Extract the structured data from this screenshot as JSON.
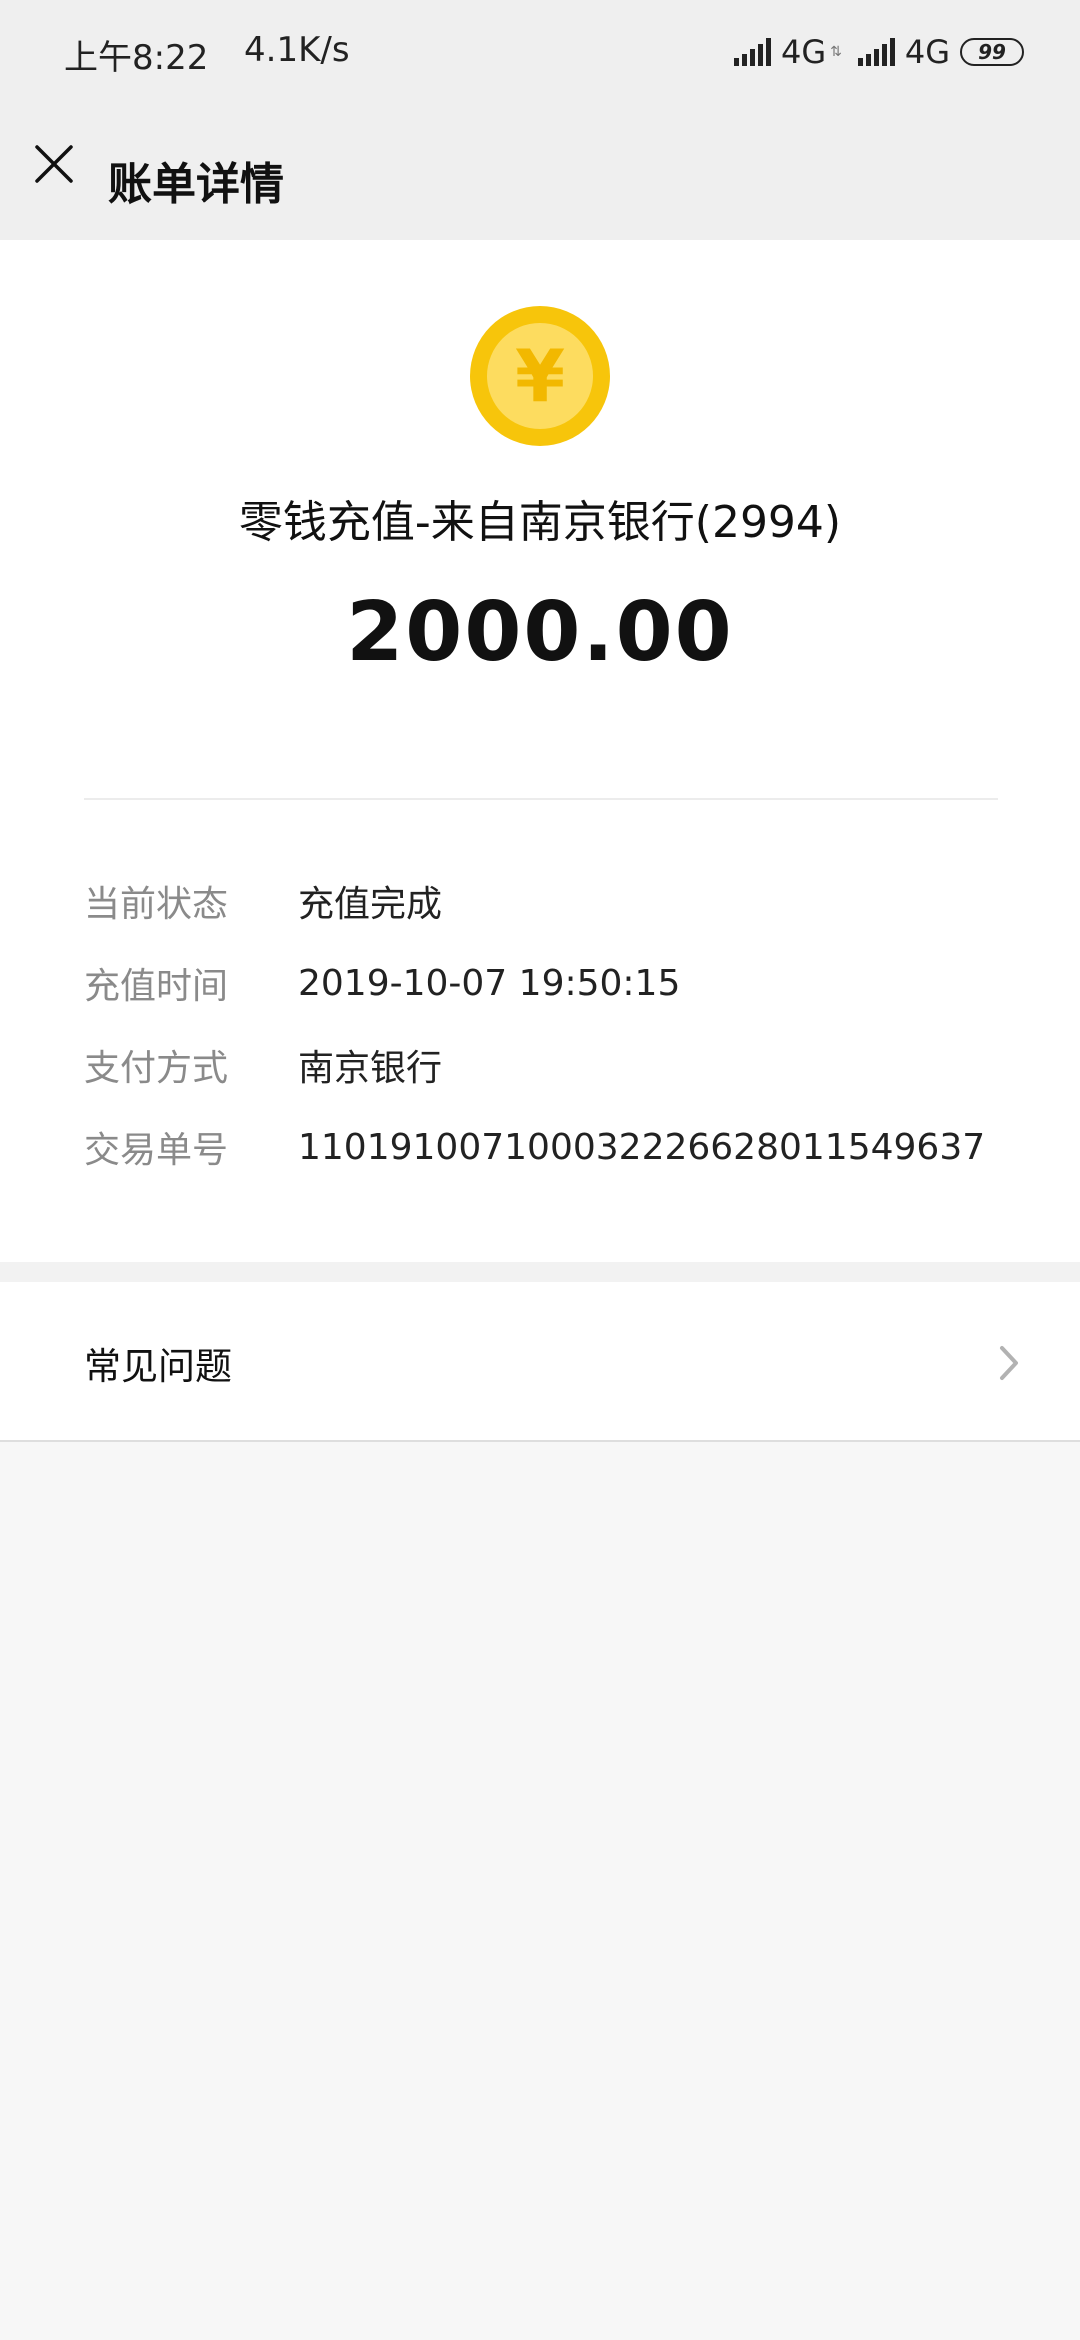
{
  "status_bar": {
    "time": "上午8:22",
    "speed": "4.1K/s",
    "network1": "4G",
    "network2": "4G",
    "battery": "99"
  },
  "header": {
    "title": "账单详情",
    "close_icon": "close-icon"
  },
  "transaction": {
    "icon": "yuan-coin-icon",
    "icon_symbol": "¥",
    "title": "零钱充值-来自南京银行(2994)",
    "amount": "2000.00"
  },
  "details": [
    {
      "label": "当前状态",
      "value": "充值完成"
    },
    {
      "label": "充值时间",
      "value": "2019-10-07 19:50:15"
    },
    {
      "label": "支付方式",
      "value": "南京银行"
    },
    {
      "label": "交易单号",
      "value": "110191007100032226628011549637"
    }
  ],
  "faq": {
    "label": "常见问题",
    "chevron_icon": "chevron-right-icon"
  },
  "colors": {
    "coin_outer": "#f7c50b",
    "coin_inner": "#fddc5f",
    "header_bg": "#efefef",
    "page_bg": "#f7f7f7"
  }
}
